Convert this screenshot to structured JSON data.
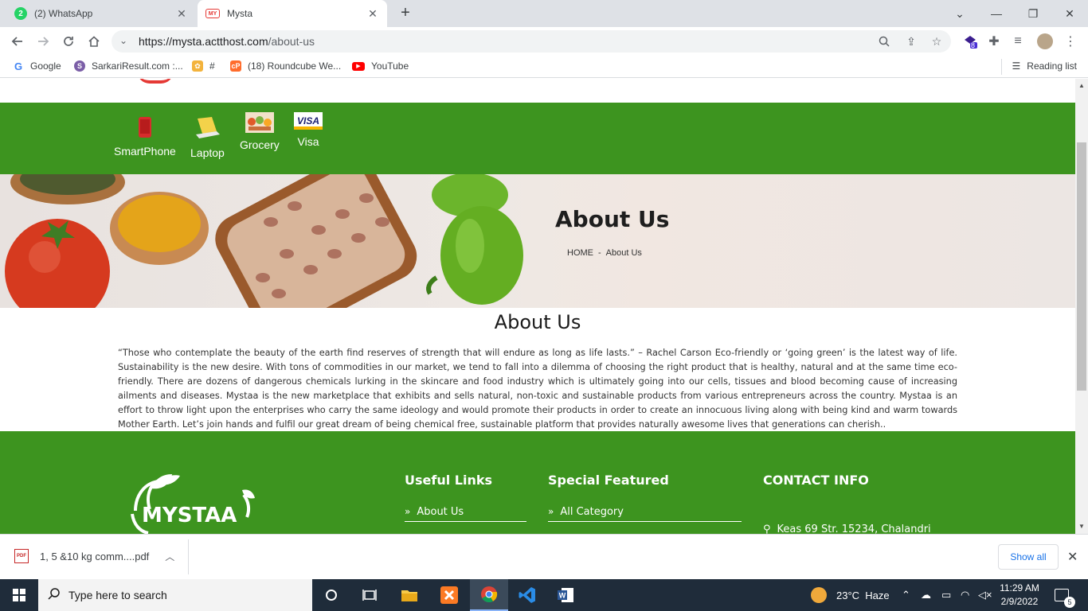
{
  "browser": {
    "tabs": [
      {
        "title": "(2) WhatsApp",
        "badge": "2",
        "active": false
      },
      {
        "title": "Mysta",
        "active": true
      }
    ],
    "url_host": "https://mysta.actthost.com",
    "url_path": "/about-us",
    "extension_badge": "8",
    "bookmarks": [
      {
        "label": "Google",
        "icon": "google-icon"
      },
      {
        "label": "SarkariResult.com :...",
        "icon": "sarkari-icon"
      },
      {
        "label": "#",
        "icon": "plant-icon"
      },
      {
        "label": "(18) Roundcube We...",
        "icon": "cpanel-icon"
      },
      {
        "label": "YouTube",
        "icon": "youtube-icon"
      }
    ],
    "reading_list": "Reading list"
  },
  "categories": [
    {
      "label": "SmartPhone",
      "icon": "smartphone-icon"
    },
    {
      "label": "Laptop",
      "icon": "laptop-icon"
    },
    {
      "label": "Grocery",
      "icon": "grocery-icon"
    },
    {
      "label": "Visa",
      "icon": "visa-icon"
    }
  ],
  "banner": {
    "title": "About Us",
    "breadcrumb_home": "HOME",
    "breadcrumb_sep": "-",
    "breadcrumb_current": "About Us"
  },
  "about": {
    "heading": "About Us",
    "body": "“Those who contemplate the beauty of the earth find reserves of strength that will endure as long as life lasts.” – Rachel Carson Eco-friendly or ‘going green’ is the latest way of life. Sustainability is the new desire. With tons of commodities in our market, we tend to fall into a dilemma of choosing the right product that is healthy, natural and at the same time eco-friendly. There are dozens of dangerous chemicals lurking in the skincare and food industry which is ultimately going into our cells, tissues and blood becoming cause of increasing ailments and diseases. Mystaa is the new marketplace that exhibits and sells natural, non-toxic and sustainable products from various entrepreneurs across the country. Mystaa is an effort to throw light upon the enterprises who carry the same ideology and would promote their products in order to create an innocuous living along with being kind and warm towards Mother Earth. Let’s join hands and fulfil our great dream of being chemical free, sustainable platform that provides naturally awesome lives that generations can cherish.."
  },
  "footer": {
    "logo_text": "MYSTAA",
    "useful_links_title": "Useful Links",
    "useful_links": [
      "About Us"
    ],
    "special_title": "Special Featured",
    "special_links": [
      "All Category"
    ],
    "contact_title": "CONTACT INFO",
    "address": "Keas 69 Str. 15234, Chalandri"
  },
  "download": {
    "filename": "1, 5 &10 kg comm....pdf",
    "file_type": "PDF",
    "show_all": "Show all"
  },
  "taskbar": {
    "search_placeholder": "Type here to search",
    "weather": "23°C  Haze",
    "time": "11:29 AM",
    "date": "2/9/2022",
    "notifications": "5"
  },
  "colors": {
    "brand_green": "#3d941f",
    "link_blue": "#1a73e8"
  }
}
